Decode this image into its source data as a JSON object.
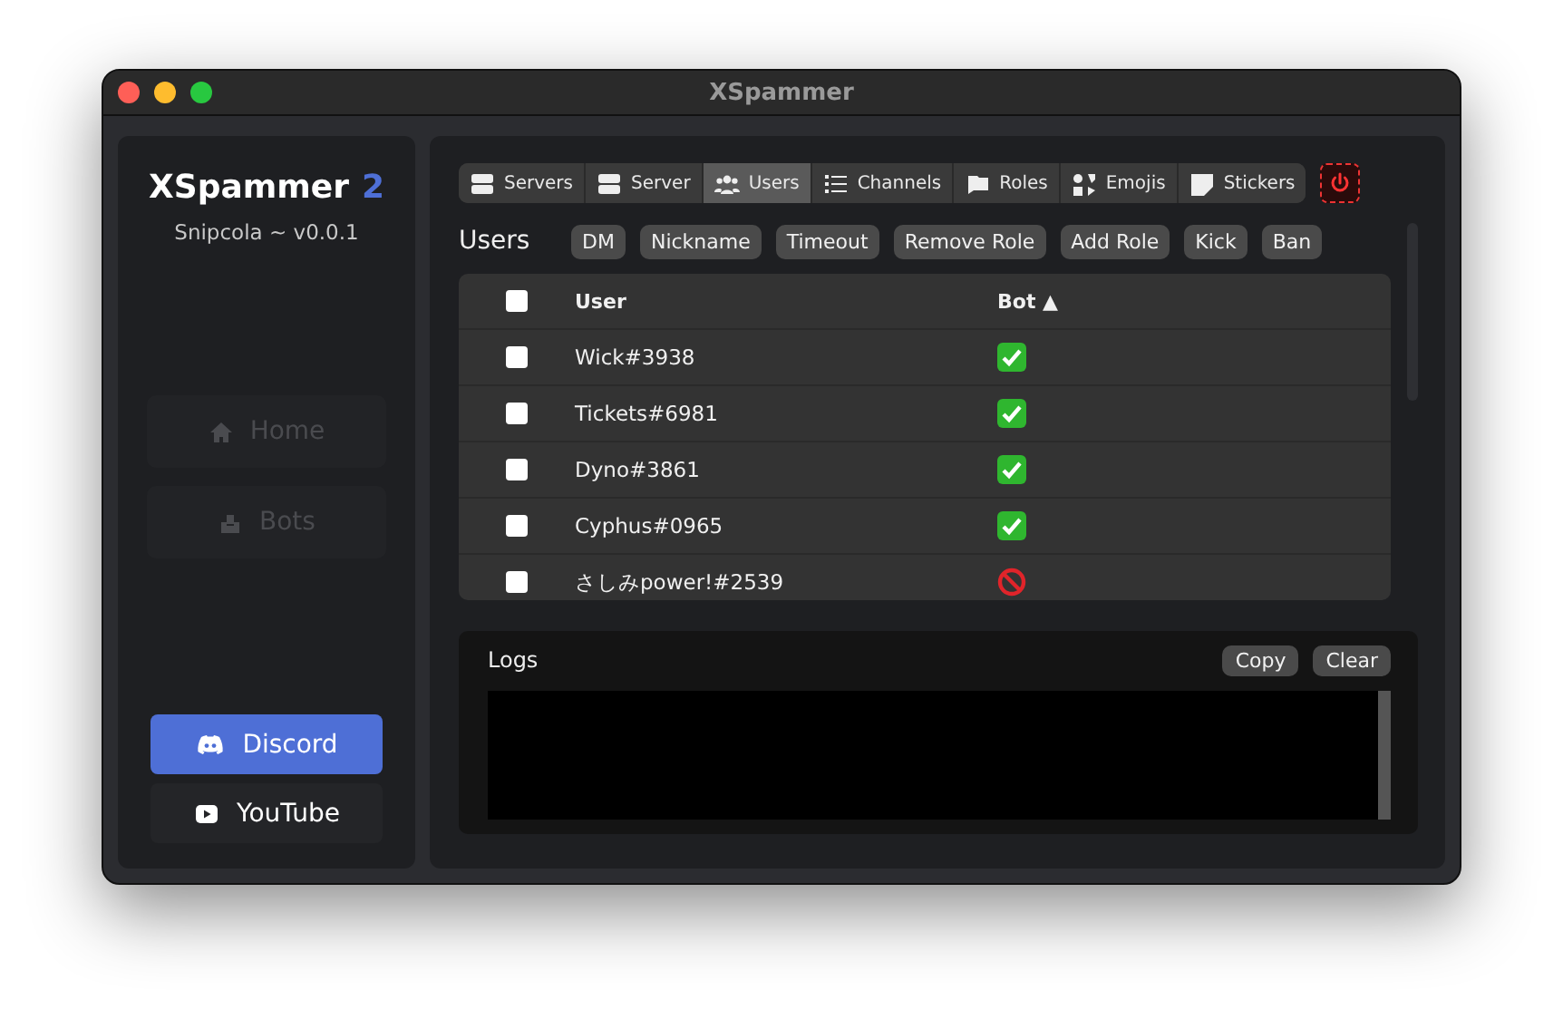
{
  "window": {
    "title": "XSpammer"
  },
  "sidebar": {
    "app_name": "XSpammer",
    "app_version_mark": "2",
    "subtitle": "Snipcola ~ v0.0.1",
    "nav": [
      {
        "label": "Home",
        "disabled": true
      },
      {
        "label": "Bots",
        "disabled": true
      }
    ],
    "links": [
      {
        "label": "Discord",
        "kind": "discord"
      },
      {
        "label": "YouTube",
        "kind": "youtube"
      }
    ]
  },
  "tabs": [
    {
      "label": "Servers",
      "selected": false
    },
    {
      "label": "Server",
      "selected": false
    },
    {
      "label": "Users",
      "selected": true
    },
    {
      "label": "Channels",
      "selected": false
    },
    {
      "label": "Roles",
      "selected": false
    },
    {
      "label": "Emojis",
      "selected": false
    },
    {
      "label": "Stickers",
      "selected": false
    }
  ],
  "section": {
    "title": "Users",
    "actions": [
      "DM",
      "Nickname",
      "Timeout",
      "Remove Role",
      "Add Role",
      "Kick",
      "Ban"
    ]
  },
  "table": {
    "select_all_checked": false,
    "columns": [
      {
        "label": "User"
      },
      {
        "label": "Bot ▲"
      }
    ],
    "rows": [
      {
        "checked": false,
        "user": "Wick#3938",
        "bot": true
      },
      {
        "checked": false,
        "user": "Tickets#6981",
        "bot": true
      },
      {
        "checked": false,
        "user": "Dyno#3861",
        "bot": true
      },
      {
        "checked": false,
        "user": "Cyphus#0965",
        "bot": true
      },
      {
        "checked": false,
        "user": "さしみpower!#2539",
        "bot": false
      }
    ]
  },
  "logs": {
    "title": "Logs",
    "buttons": [
      "Copy",
      "Clear"
    ]
  }
}
